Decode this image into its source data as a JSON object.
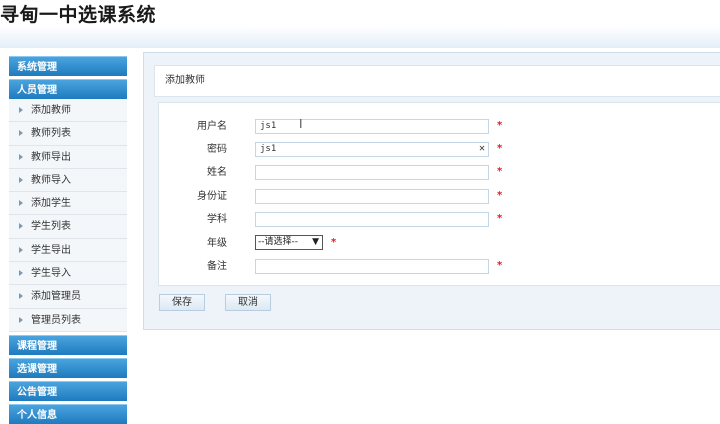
{
  "app": {
    "title": "寻甸一中选课系统"
  },
  "sidebar": {
    "sections": [
      {
        "label": "系统管理"
      },
      {
        "label": "人员管理",
        "items": [
          "添加教师",
          "教师列表",
          "教师导出",
          "教师导入",
          "添加学生",
          "学生列表",
          "学生导出",
          "学生导入",
          "添加管理员",
          "管理员列表"
        ]
      },
      {
        "label": "课程管理"
      },
      {
        "label": "选课管理"
      },
      {
        "label": "公告管理"
      },
      {
        "label": "个人信息"
      }
    ]
  },
  "form": {
    "title": "添加教师",
    "fields": {
      "username": {
        "label": "用户名",
        "value": "js1",
        "required": "*"
      },
      "password": {
        "label": "密码",
        "value": "js1",
        "required": "*"
      },
      "name": {
        "label": "姓名",
        "value": "",
        "required": "*"
      },
      "id_card": {
        "label": "身份证",
        "value": "",
        "required": "*"
      },
      "subject": {
        "label": "学科",
        "value": "",
        "required": "*"
      },
      "grade": {
        "label": "年级",
        "selected": "--请选择--",
        "required": "*"
      },
      "remark": {
        "label": "备注",
        "value": "",
        "required": "*"
      }
    },
    "save_label": "保存",
    "cancel_label": "取消"
  },
  "icons": {
    "clear": "close-icon",
    "cursor": "text-cursor-icon",
    "arrow": "arrow-right-icon",
    "dropdown": "chevron-down-icon"
  },
  "colors": {
    "accent": "#1f7bbf",
    "required": "#e02020",
    "panel_bg": "#edf3f8"
  }
}
